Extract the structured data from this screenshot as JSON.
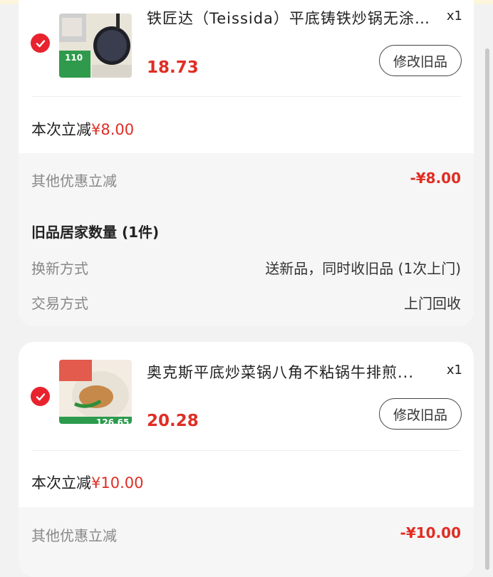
{
  "items": [
    {
      "title": "铁匠达（Teissida）平底铸铁炒锅无涂层...",
      "quantity": "x1",
      "price": "18.73",
      "thumb_badge": "110",
      "modify_label": "修改旧品",
      "save_label": "本次立减",
      "save_amount": "¥8.00",
      "other_label": "其他优惠立减",
      "other_amount": "-¥8.00"
    },
    {
      "title": "奥克斯平底炒菜锅八角不粘锅牛排煎...",
      "quantity": "x1",
      "price": "20.28",
      "thumb_badge": "126.65",
      "modify_label": "修改旧品",
      "save_label": "本次立减",
      "save_amount": "¥10.00",
      "other_label": "其他优惠立减",
      "other_amount": "-¥10.00"
    }
  ],
  "old_items": {
    "title": "旧品居家数量 (1件)",
    "method_label": "换新方式",
    "method_value": "送新品，同时收旧品 (1次上门)",
    "trade_label": "交易方式",
    "trade_value": "上门回收"
  },
  "colors": {
    "accent": "#e02e24",
    "check": "#e8232e",
    "background": "#f2f2f2"
  },
  "icons": [
    "checkmark-icon"
  ]
}
